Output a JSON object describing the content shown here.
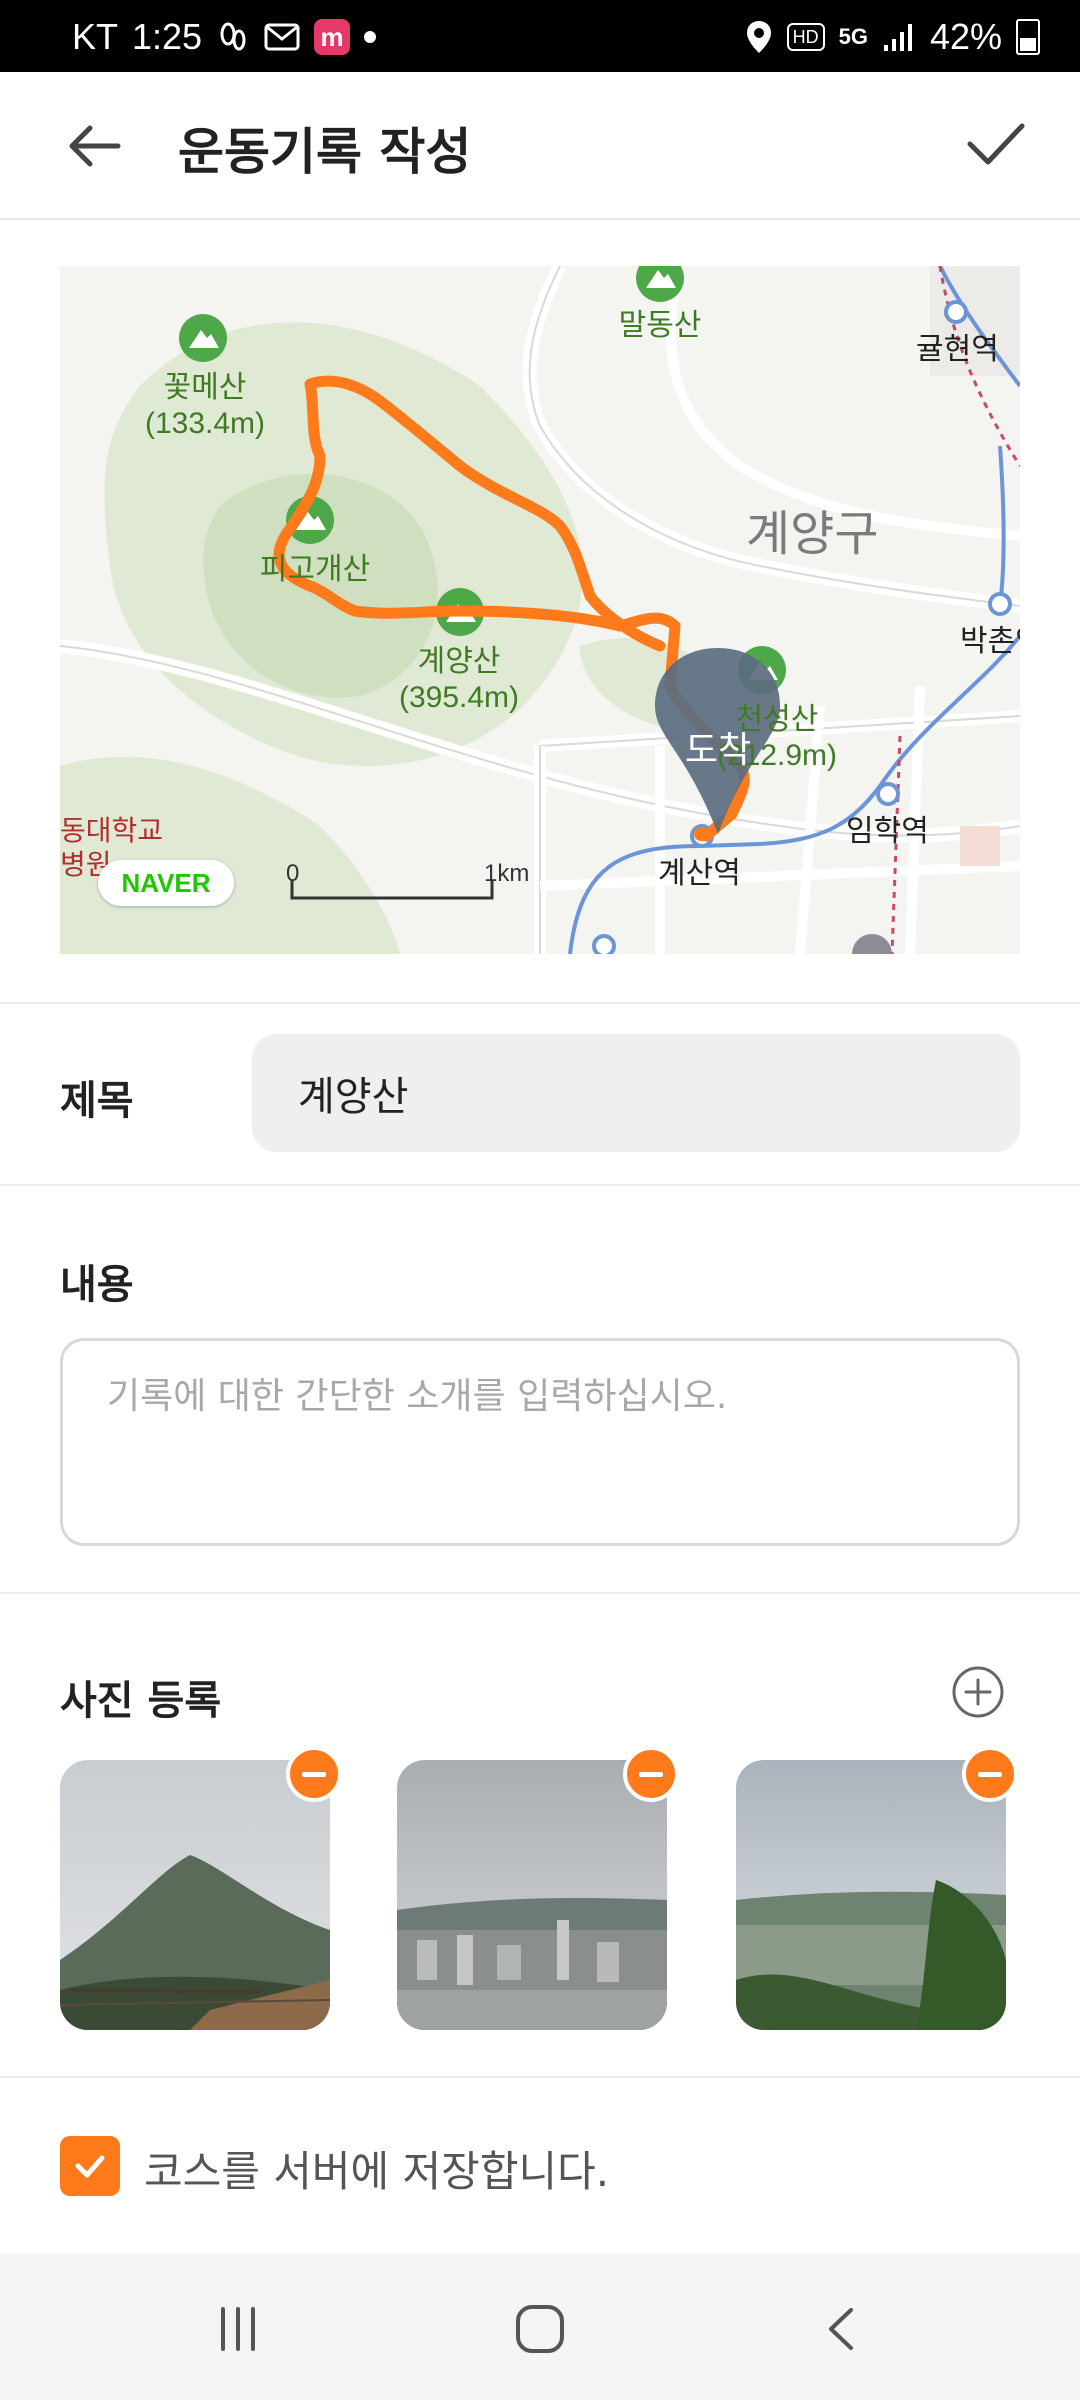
{
  "status_bar": {
    "carrier": "KT",
    "time": "1:25",
    "hd": "HD",
    "network": "5G",
    "battery": "42%"
  },
  "header": {
    "title": "운동기록 작성"
  },
  "map": {
    "peaks": [
      {
        "name": "꽃메산",
        "height": "(133.4m)"
      },
      {
        "name": "말동산",
        "height": ""
      },
      {
        "name": "피고개산",
        "height": ""
      },
      {
        "name": "계양산",
        "height": "(395.4m)"
      },
      {
        "name": "천성산",
        "height": "(212.9m)"
      }
    ],
    "district": "계양구",
    "stations": [
      "귤현역",
      "박촌역",
      "임학역",
      "계산역"
    ],
    "school": [
      "동대학교",
      "병원"
    ],
    "provider": "NAVER",
    "scale_start": "0",
    "scale_end": "1km",
    "arrival_marker": "도착",
    "route_color": "#ff7a1a"
  },
  "form": {
    "title_label": "제목",
    "title_value": "계양산",
    "content_label": "내용",
    "content_placeholder": "기록에 대한 간단한 소개를 입력하십시오.",
    "photos_label": "사진 등록",
    "photos": [
      {
        "desc": "mountain-view"
      },
      {
        "desc": "city-view"
      },
      {
        "desc": "valley-view"
      }
    ],
    "save_course_checked": true,
    "save_course_label": "코스를 서버에 저장합니다."
  },
  "colors": {
    "accent": "#ff7a1a",
    "map_green": "#3f7a25"
  }
}
